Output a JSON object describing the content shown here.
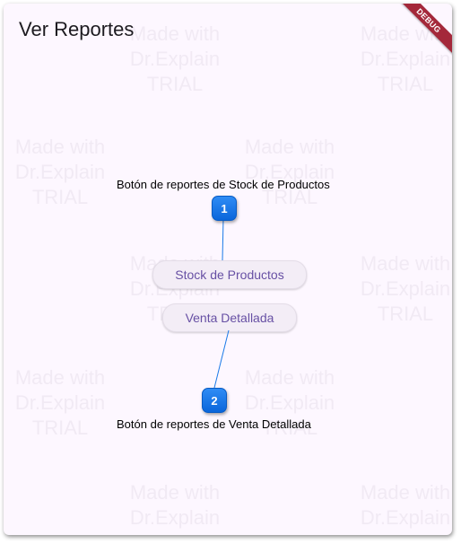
{
  "app": {
    "title": "Ver Reportes",
    "debug_banner": "DEBUG"
  },
  "buttons": {
    "stock": "Stock de Productos",
    "venta": "Venta Detallada"
  },
  "callouts": [
    {
      "number": "1",
      "text": "Botón de reportes de Stock de Productos"
    },
    {
      "number": "2",
      "text": "Botón de reportes de Venta Detallada"
    }
  ],
  "watermark": {
    "text": "Made with\nDr.Explain\nTRIAL"
  },
  "colors": {
    "background": "#fdf7ff",
    "button_text": "#6750a4",
    "badge": "#1a7ae8",
    "debug_banner": "#a4283a"
  }
}
